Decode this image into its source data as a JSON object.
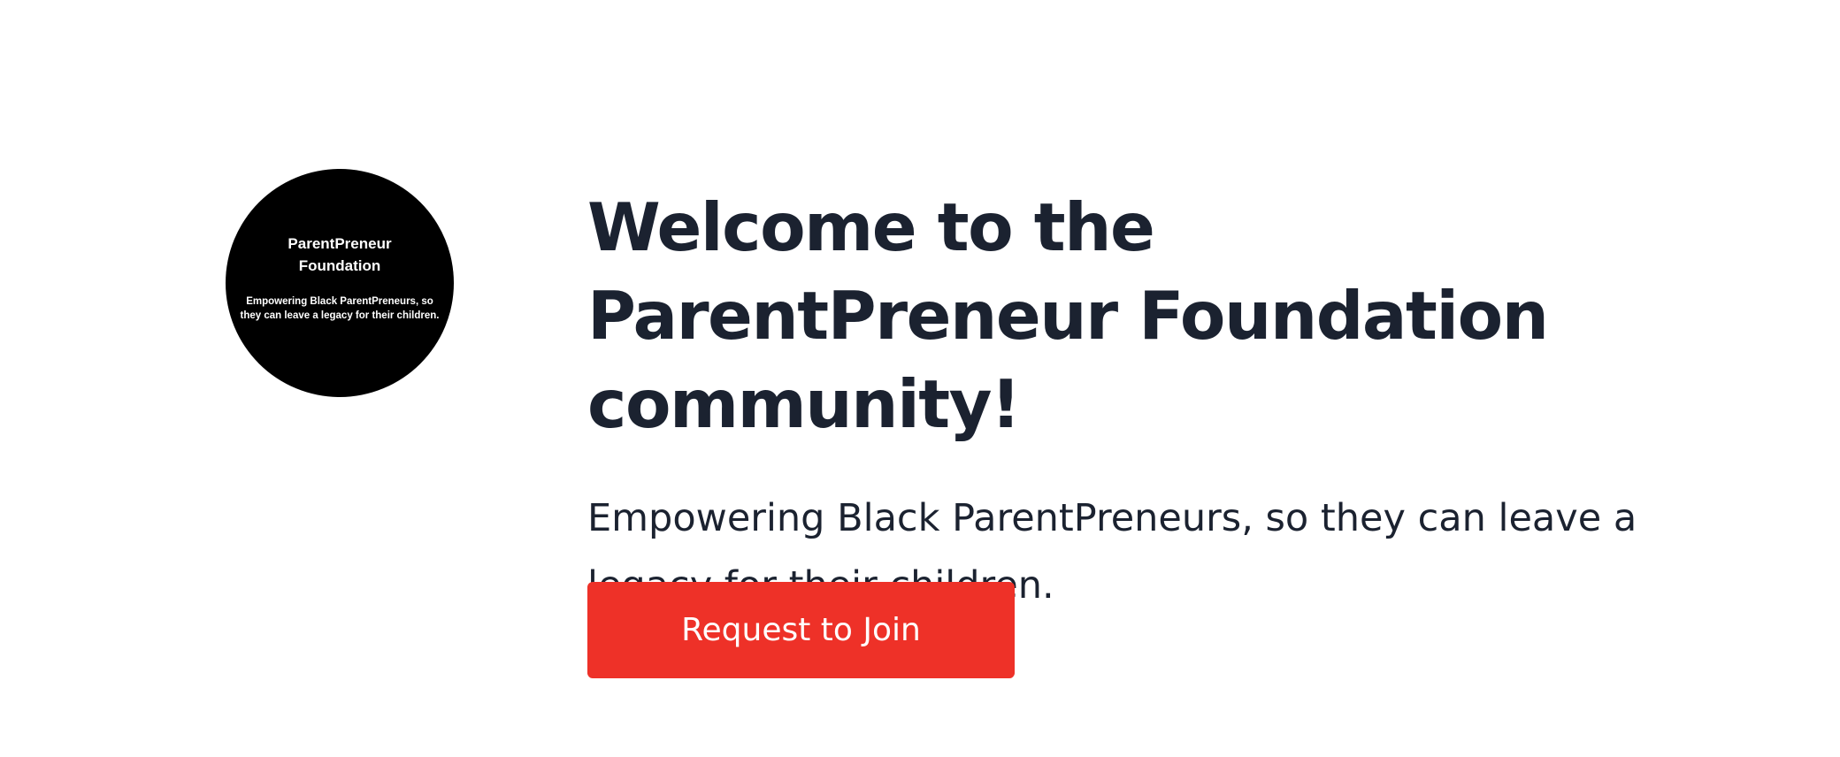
{
  "logo": {
    "name_line1": "ParentPreneur",
    "name_line2": "Foundation",
    "tagline": "Empowering Black ParentPreneurs, so they can leave a legacy for their children."
  },
  "hero": {
    "title": "Welcome to the ParentPreneur Foundation community!",
    "subtitle": "Empowering Black ParentPreneurs, so they can leave a legacy for their children.",
    "button_label": "Request to Join"
  },
  "colors": {
    "background": "#ffffff",
    "text": "#1b2230",
    "button": "#ee3128",
    "logo_background": "#000000"
  }
}
